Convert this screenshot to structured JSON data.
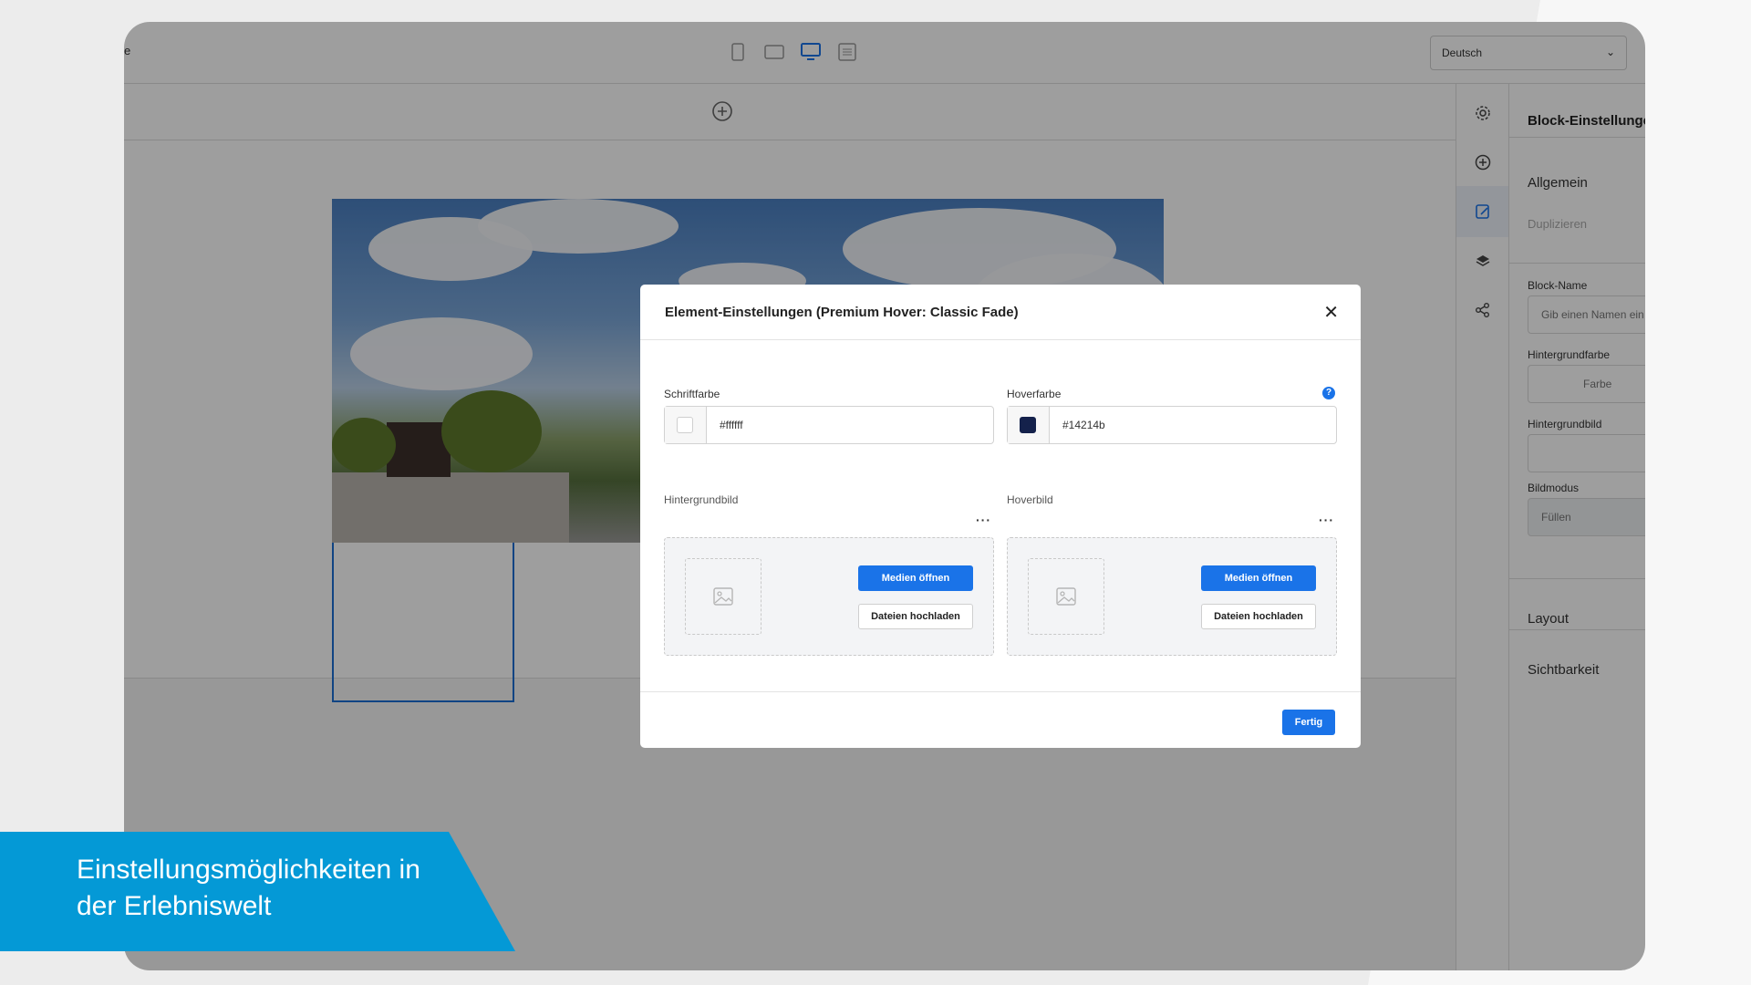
{
  "topbar": {
    "crumb": "e",
    "language": "Deutsch"
  },
  "sidebar": {
    "title": "Block-Einstellungen",
    "general": "Allgemein",
    "duplicate": "Duplizieren",
    "block_name_label": "Block-Name",
    "block_name_placeholder": "Gib einen Namen ein",
    "bg_color_label": "Hintergrundfarbe",
    "bg_color_value": "Farbe",
    "bg_image_label": "Hintergrundbild",
    "image_mode_label": "Bildmodus",
    "image_mode_value": "Füllen",
    "layout": "Layout",
    "visibility": "Sichtbarkeit"
  },
  "modal": {
    "title": "Element-Einstellungen (Premium Hover: Classic Fade)",
    "font_color_label": "Schriftfarbe",
    "font_color_value": "#ffffff",
    "hover_color_label": "Hoverfarbe",
    "hover_color_value": "#14214b",
    "bg_image_label": "Hintergrundbild",
    "hover_image_label": "Hoverbild",
    "open_media": "Medien öffnen",
    "upload_files": "Dateien hochladen",
    "done": "Fertig",
    "info": "?",
    "more": "···",
    "close": "✕"
  },
  "caption": {
    "text": "Einstellungsmöglichkeiten in der Erlebniswelt"
  },
  "colors": {
    "accent": "#1a73e8",
    "caption_bg": "#0499d6",
    "hover_swatch": "#14214b",
    "font_swatch": "#ffffff"
  }
}
